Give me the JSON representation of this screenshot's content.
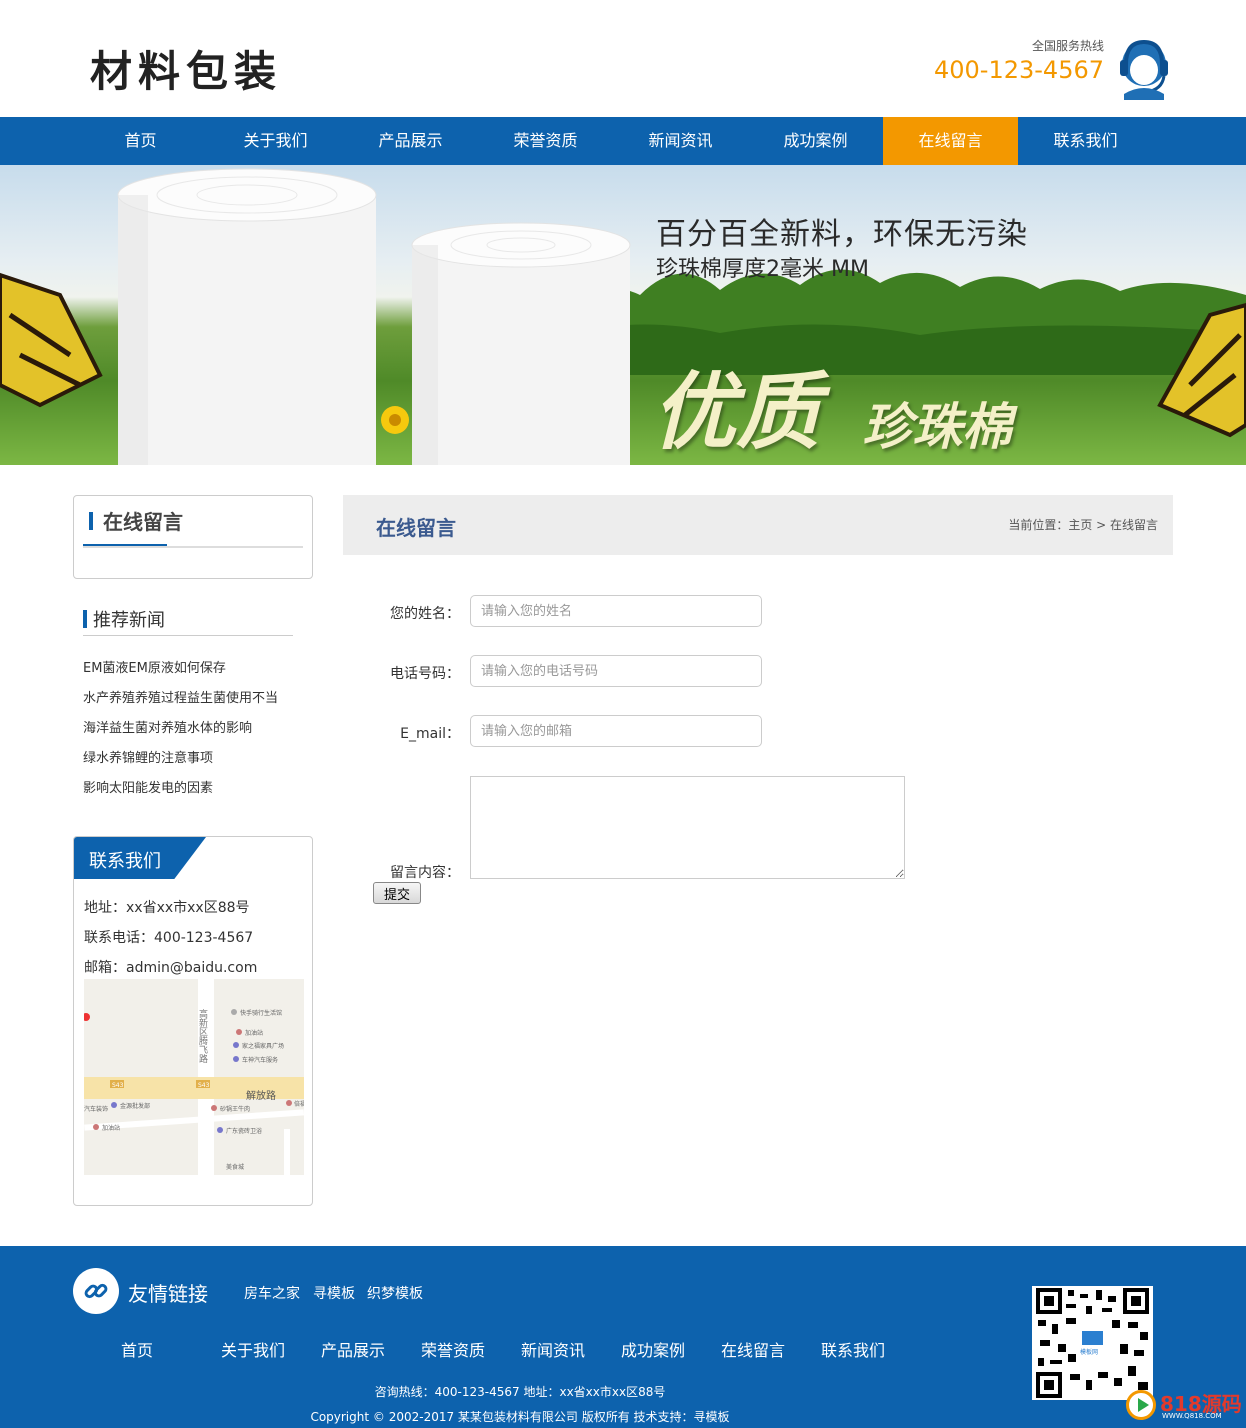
{
  "header": {
    "logo": "材料包装",
    "hotline_label": "全国服务热线",
    "hotline_number": "400-123-4567"
  },
  "nav": [
    {
      "label": "首页"
    },
    {
      "label": "关于我们"
    },
    {
      "label": "产品展示"
    },
    {
      "label": "荣誉资质"
    },
    {
      "label": "新闻资讯"
    },
    {
      "label": "成功案例"
    },
    {
      "label": "在线留言",
      "active": true
    },
    {
      "label": "联系我们"
    }
  ],
  "banner": {
    "line1": "百分百全新料，环保无污染",
    "line2": "珍珠棉厚度2毫米 MM",
    "big1": "优质",
    "big2": "珍珠棉"
  },
  "sidebar": {
    "category_title": "在线留言",
    "news_title": "推荐新闻",
    "news": [
      "EM菌液EM原液如何保存",
      "水产养殖养殖过程益生菌使用不当",
      "海洋益生菌对养殖水体的影响",
      "绿水养锦鲤的注意事项",
      "影响太阳能发电的因素"
    ],
    "contact_title": "联系我们",
    "address": "地址：xx省xx市xx区88号",
    "phone": "联系电话：400-123-4567",
    "email": "邮箱：admin@baidu.com",
    "map_labels": {
      "road_vertical": "高新区腾飞路",
      "road_horizontal": "解放路",
      "poi1": "快手骑行生活馆",
      "poi2": "加油站",
      "poi3": "家之福家具广场",
      "poi4": "车神汽车服务",
      "poi5": "金源批发部",
      "poi6": "砂锅王牛肉",
      "poi7": "广东瓷砖卫浴",
      "poi8": "加油站",
      "poi9": "汽车装饰",
      "poi10": "倍福",
      "poi11": "美食城",
      "badge1": "S43",
      "badge2": "S43"
    }
  },
  "main": {
    "title": "在线留言",
    "breadcrumb": "当前位置：主页 > 在线留言",
    "form": {
      "name_label": "您的姓名：",
      "name_placeholder": "请输入您的姓名",
      "phone_label": "电话号码：",
      "phone_placeholder": "请输入您的电话号码",
      "email_label": "E_mail：",
      "email_placeholder": "请输入您的邮箱",
      "message_label": "留言内容：",
      "submit_label": "提交"
    }
  },
  "footer": {
    "links_title": "友情链接",
    "links": [
      "房车之家",
      "寻模板",
      "织梦模板"
    ],
    "nav": [
      "首页",
      "关于我们",
      "产品展示",
      "荣誉资质",
      "新闻资讯",
      "成功案例",
      "在线留言",
      "联系我们"
    ],
    "contact_line": "咨询热线：400-123-4567 地址：xx省xx市xx区88号",
    "copyright": "Copyright © 2002-2017 某某包装材料有限公司 版权所有 技术支持：寻模板",
    "qr_caption": "模板网"
  },
  "watermark": {
    "text": "818源码",
    "url": "WWW.Q818.COM"
  },
  "colors": {
    "brand_blue": "#0d62ad",
    "accent_orange": "#f39800"
  }
}
